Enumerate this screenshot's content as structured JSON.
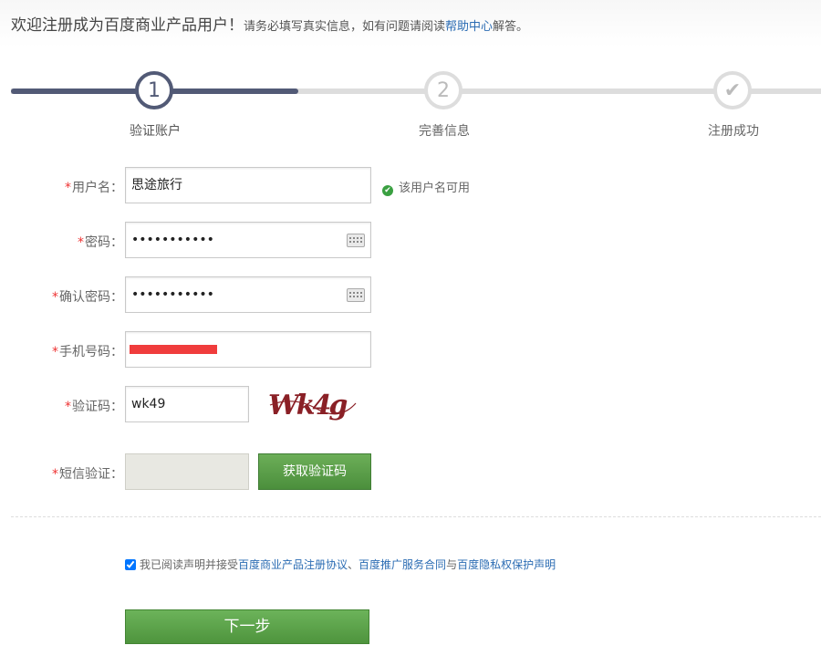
{
  "header": {
    "welcome_big": "欢迎注册成为百度商业产品用户！",
    "welcome_small": "请务必填写真实信息，如有问题请阅读",
    "help_link": "帮助中心",
    "welcome_end": "解答。"
  },
  "steps": [
    {
      "number": "1",
      "label": "验证账户",
      "state": "active"
    },
    {
      "number": "2",
      "label": "完善信息",
      "state": "pending"
    },
    {
      "number": "✔",
      "label": "注册成功",
      "state": "pending"
    }
  ],
  "form": {
    "required_mark": "*",
    "username": {
      "label": "用户名：",
      "value": "思途旅行",
      "status": "该用户名可用"
    },
    "password": {
      "label": "密码：",
      "value": "•••••••••••"
    },
    "confirm_password": {
      "label": "确认密码：",
      "value": "•••••••••••"
    },
    "phone": {
      "label": "手机号码：",
      "value": ""
    },
    "captcha": {
      "label": "验证码：",
      "value": "wk49",
      "image_text": "Wk4g"
    },
    "sms": {
      "label": "短信验证：",
      "value": "",
      "button": "获取验证码"
    }
  },
  "agreement": {
    "checked": true,
    "prefix": "我已阅读声明并接受",
    "link1": "百度商业产品注册协议",
    "sep1": "、",
    "link2": "百度推广服务合同",
    "sep2": "与",
    "link3": "百度隐私权保护声明"
  },
  "next_button": "下一步",
  "colors": {
    "active_step": "#525a76",
    "button_green": "#5a9f48",
    "link_blue": "#2b6cb3",
    "required_red": "#ee3333",
    "ok_green": "#3aa041"
  }
}
